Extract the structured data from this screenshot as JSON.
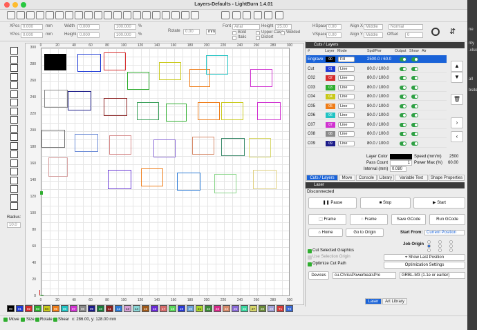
{
  "window": {
    "title": "Layers-Defaults - LightBurn 1.4.01"
  },
  "background_snippets": [
    "rity",
    ".xlsx",
    "bsite",
    "all",
    "ne"
  ],
  "props": {
    "xpos_label": "XPos",
    "xpos_value": "0.000",
    "ypos_label": "YPos",
    "ypos_value": "0.000",
    "unit": "mm",
    "width_label": "Width",
    "width_value": "0.000",
    "height_label": "Height",
    "height_value": "0.000",
    "pct1": "100.000",
    "pct2": "100.000",
    "pct_unit": "%",
    "rotate_label": "Rotate",
    "rotate_value": "0.00",
    "rotate_unit": "mm",
    "font_label": "Font",
    "font_value": "Arial",
    "height2_label": "Height",
    "height2_value": "25.00",
    "hspace_label": "HSpace",
    "hspace_value": "0.00",
    "vspace_label": "VSpace",
    "vspace_value": "0.00",
    "alignx_label": "Align X",
    "alignx_value": "Middle",
    "aligny_label": "Align Y",
    "aligny_value": "Middle",
    "normal_value": "Normal",
    "offset_label": "Offset",
    "offset_value": "0",
    "bold": "Bold",
    "italic": "Italic",
    "upper": "Upper Case",
    "distort": "Distort",
    "welded": "Welded"
  },
  "tools": {
    "radius_label": "Radius:",
    "radius_value": "10.0"
  },
  "ruler": {
    "y": [
      "300",
      "280",
      "260",
      "240",
      "220",
      "200",
      "180",
      "160",
      "140",
      "120",
      "100",
      "80",
      "60",
      "40",
      "20",
      "0"
    ],
    "x": [
      "0",
      "20",
      "40",
      "60",
      "80",
      "100",
      "120",
      "140",
      "160",
      "180",
      "200",
      "220",
      "240",
      "260",
      "280",
      "300"
    ],
    "x_bottom": [
      "0",
      "20",
      "40",
      "60",
      "80",
      "100",
      "120",
      "140",
      "160",
      "180",
      "200",
      "220",
      "240",
      "260",
      "280",
      "300"
    ]
  },
  "cuts": {
    "panel_title": "Cuts / Layers",
    "headers": [
      "#",
      "Layer",
      "Mode",
      "Spd/Pwr",
      "Output",
      "Show",
      "Air"
    ],
    "rows": [
      {
        "name": "Engrave",
        "num": "00",
        "color": "#000000",
        "mode": "Fill",
        "spd": "2500.0 / 60.0",
        "selected": true
      },
      {
        "name": "Cut",
        "num": "01",
        "color": "#1f3bd6",
        "mode": "Line",
        "spd": "80.0 / 100.0"
      },
      {
        "name": "C02",
        "num": "02",
        "color": "#d62b2b",
        "mode": "Line",
        "spd": "80.0 / 100.0"
      },
      {
        "name": "C03",
        "num": "03",
        "color": "#2fae2f",
        "mode": "Line",
        "spd": "80.0 / 100.0"
      },
      {
        "name": "C04",
        "num": "04",
        "color": "#c9c91a",
        "mode": "Line",
        "spd": "80.0 / 100.0"
      },
      {
        "name": "C05",
        "num": "05",
        "color": "#ef7d19",
        "mode": "Line",
        "spd": "80.0 / 100.0"
      },
      {
        "name": "C06",
        "num": "06",
        "color": "#22c3c3",
        "mode": "Line",
        "spd": "80.0 / 100.0"
      },
      {
        "name": "C07",
        "num": "07",
        "color": "#d032d0",
        "mode": "Line",
        "spd": "80.0 / 100.0"
      },
      {
        "name": "C08",
        "num": "08",
        "color": "#8a8a8a",
        "mode": "Line",
        "spd": "80.0 / 100.0"
      },
      {
        "name": "C09",
        "num": "09",
        "color": "#1d1d8a",
        "mode": "Line",
        "spd": "80.0 / 100.0"
      }
    ],
    "layer_color_label": "Layer Color",
    "speed_label": "Speed (mm/m)",
    "speed_value": "2500",
    "pass_label": "Pass Count",
    "pass_value": "1",
    "power_label": "Power Max (%)",
    "power_value": "60.00",
    "interval_label": "Interval (mm)",
    "interval_value": "0.080"
  },
  "tabs": {
    "items": [
      "Cuts / Layers",
      "Move",
      "Console",
      "Library",
      "Variable Text",
      "Shape Properties"
    ]
  },
  "laser": {
    "panel_title": "Laser",
    "status": "Disconnected",
    "pause": "Pause",
    "stop": "Stop",
    "start": "Start",
    "frame1": "Frame",
    "frame2": "Frame",
    "save": "Save GCode",
    "run": "Run GCode",
    "home": "Home",
    "goto": "Go to Origin",
    "start_from_label": "Start From:",
    "start_from_value": "Current Position",
    "job_origin": "Job Origin",
    "cut_selected": "Cut Selected Graphics",
    "use_selection": "Use Selection Origin",
    "optimize": "Optimize Cut Path",
    "show_last": "Show Last Position",
    "opt_settings": "Optimization Settings",
    "devices": "Devices",
    "device_value": "cu.ChrissPowerbeatsPro",
    "grbl_value": "GRBL-M3 (1.1e or earlier)"
  },
  "bottom_tabs": [
    "Laser",
    "Art Library"
  ],
  "palette": [
    {
      "n": "00",
      "c": "#000000"
    },
    {
      "n": "01",
      "c": "#1f3bd6"
    },
    {
      "n": "02",
      "c": "#d62b2b"
    },
    {
      "n": "03",
      "c": "#2fae2f"
    },
    {
      "n": "04",
      "c": "#c9c91a"
    },
    {
      "n": "05",
      "c": "#ef7d19"
    },
    {
      "n": "06",
      "c": "#22c3c3"
    },
    {
      "n": "07",
      "c": "#d032d0"
    },
    {
      "n": "08",
      "c": "#8a8a8a"
    },
    {
      "n": "09",
      "c": "#1d1d8a"
    },
    {
      "n": "10",
      "c": "#1a7a3a"
    },
    {
      "n": "11",
      "c": "#8a1f1f"
    },
    {
      "n": "12",
      "c": "#2a7ad6"
    },
    {
      "n": "13",
      "c": "#d6a0d6"
    },
    {
      "n": "14",
      "c": "#8ad6d6"
    },
    {
      "n": "15",
      "c": "#a05a1a"
    },
    {
      "n": "16",
      "c": "#6a2ad6"
    },
    {
      "n": "17",
      "c": "#d66a6a"
    },
    {
      "n": "18",
      "c": "#5ad65a"
    },
    {
      "n": "19",
      "c": "#2a3ad6"
    },
    {
      "n": "20",
      "c": "#6aa0d6"
    },
    {
      "n": "21",
      "c": "#aad62a"
    },
    {
      "n": "22",
      "c": "#3a8a3a"
    },
    {
      "n": "23",
      "c": "#d62a8a"
    },
    {
      "n": "24",
      "c": "#d68a6a"
    },
    {
      "n": "25",
      "c": "#8a6ad6"
    },
    {
      "n": "26",
      "c": "#3ad6a0"
    },
    {
      "n": "27",
      "c": "#d6d66a"
    },
    {
      "n": "28",
      "c": "#6a8a3a"
    },
    {
      "n": "29",
      "c": "#a0a0d6"
    },
    {
      "n": "T1",
      "c": "#d63a3a"
    },
    {
      "n": "T2",
      "c": "#3a6ad6"
    }
  ],
  "status": {
    "move": "Move",
    "size": "Size",
    "rotate": "Rotate",
    "shear": "Shear",
    "coords": "x: 286.00, y: 128.00 mm"
  }
}
